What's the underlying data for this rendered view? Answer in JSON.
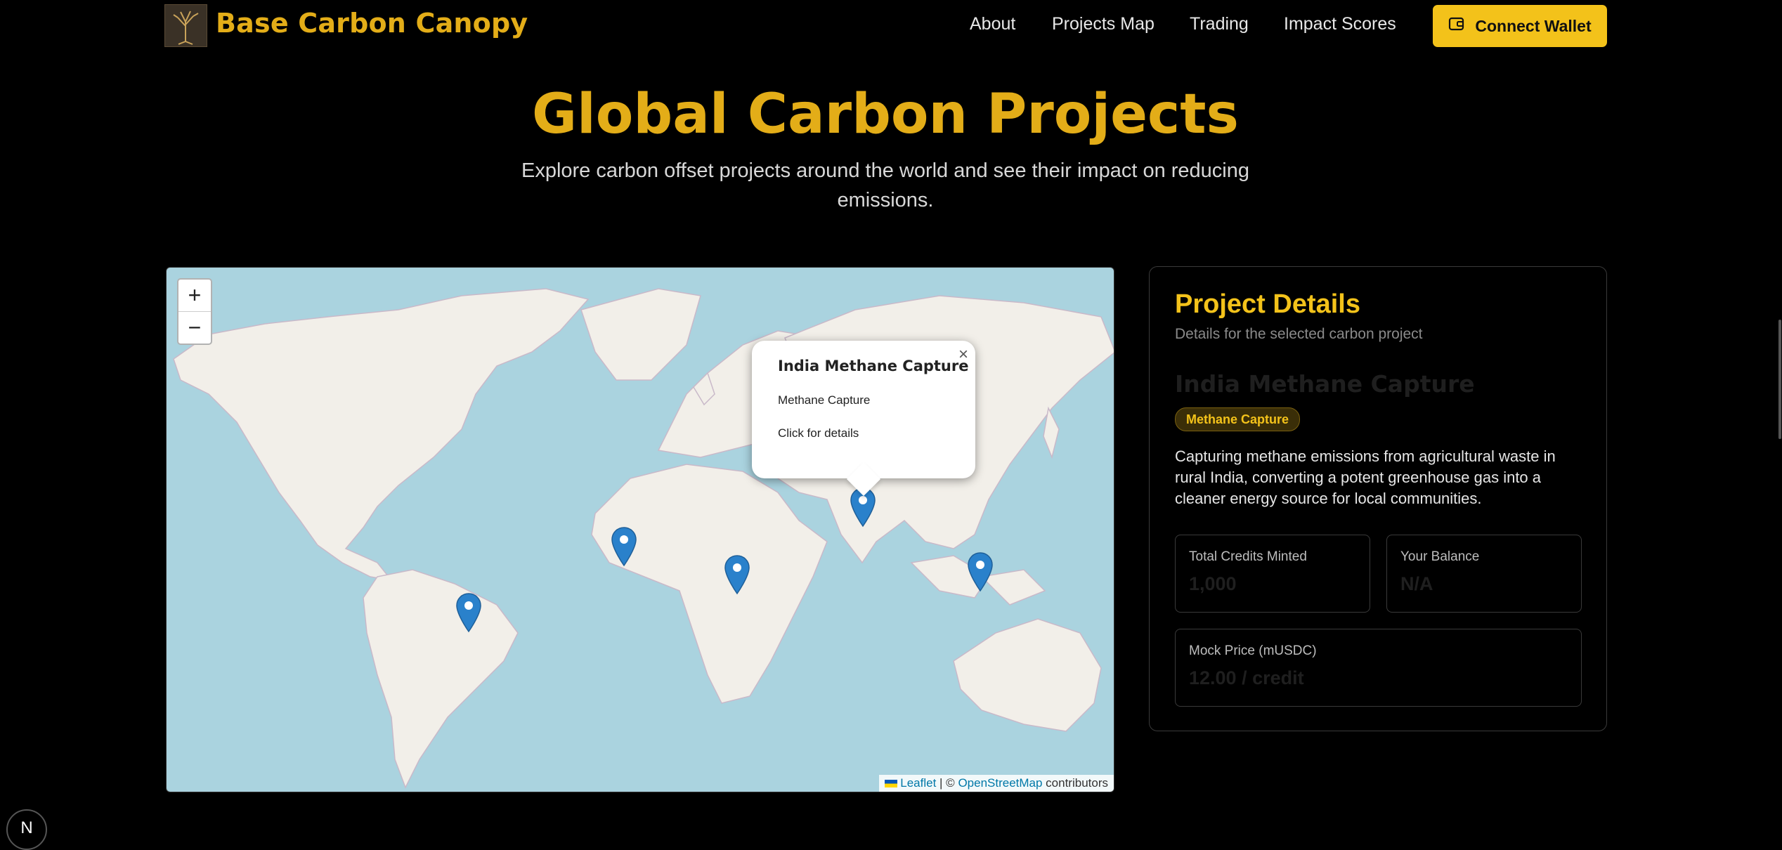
{
  "header": {
    "brand": "Base Carbon Canopy",
    "logo_icon": "tree-roots-icon",
    "nav": [
      {
        "label": "About"
      },
      {
        "label": "Projects Map"
      },
      {
        "label": "Trading"
      },
      {
        "label": "Impact Scores"
      }
    ],
    "wallet_button": {
      "label": "Connect Wallet",
      "icon": "wallet-icon"
    }
  },
  "hero": {
    "title": "Global Carbon Projects",
    "subtitle": "Explore carbon offset projects around the world and see their impact on reducing emissions."
  },
  "map": {
    "zoom_in": "+",
    "zoom_out": "−",
    "attribution": {
      "leaflet": "Leaflet",
      "separator": " | © ",
      "osm": "OpenStreetMap",
      "suffix": " contributors"
    },
    "popup": {
      "title": "India Methane Capture",
      "type": "Methane Capture",
      "action": "Click for details",
      "close": "×"
    },
    "marker_icon": "map-pin-icon"
  },
  "details": {
    "title": "Project Details",
    "subtitle": "Details for the selected carbon project",
    "project_name": "India Methane Capture",
    "badge": "Methane Capture",
    "description": "Capturing methane emissions from agricultural waste in rural India, converting a potent greenhouse gas into a cleaner energy source for local communities.",
    "stats": {
      "total_credits": {
        "label": "Total Credits Minted",
        "value": "1,000"
      },
      "balance": {
        "label": "Your Balance",
        "value": "N/A"
      },
      "price": {
        "label": "Mock Price (mUSDC)",
        "value": "12.00 / credit"
      }
    }
  },
  "corner_badge": "N",
  "colors": {
    "accent": "#e3ad18",
    "button": "#f3c21a",
    "water": "#aad3df",
    "land": "#f2efe9",
    "marker": "#2a81cb"
  }
}
